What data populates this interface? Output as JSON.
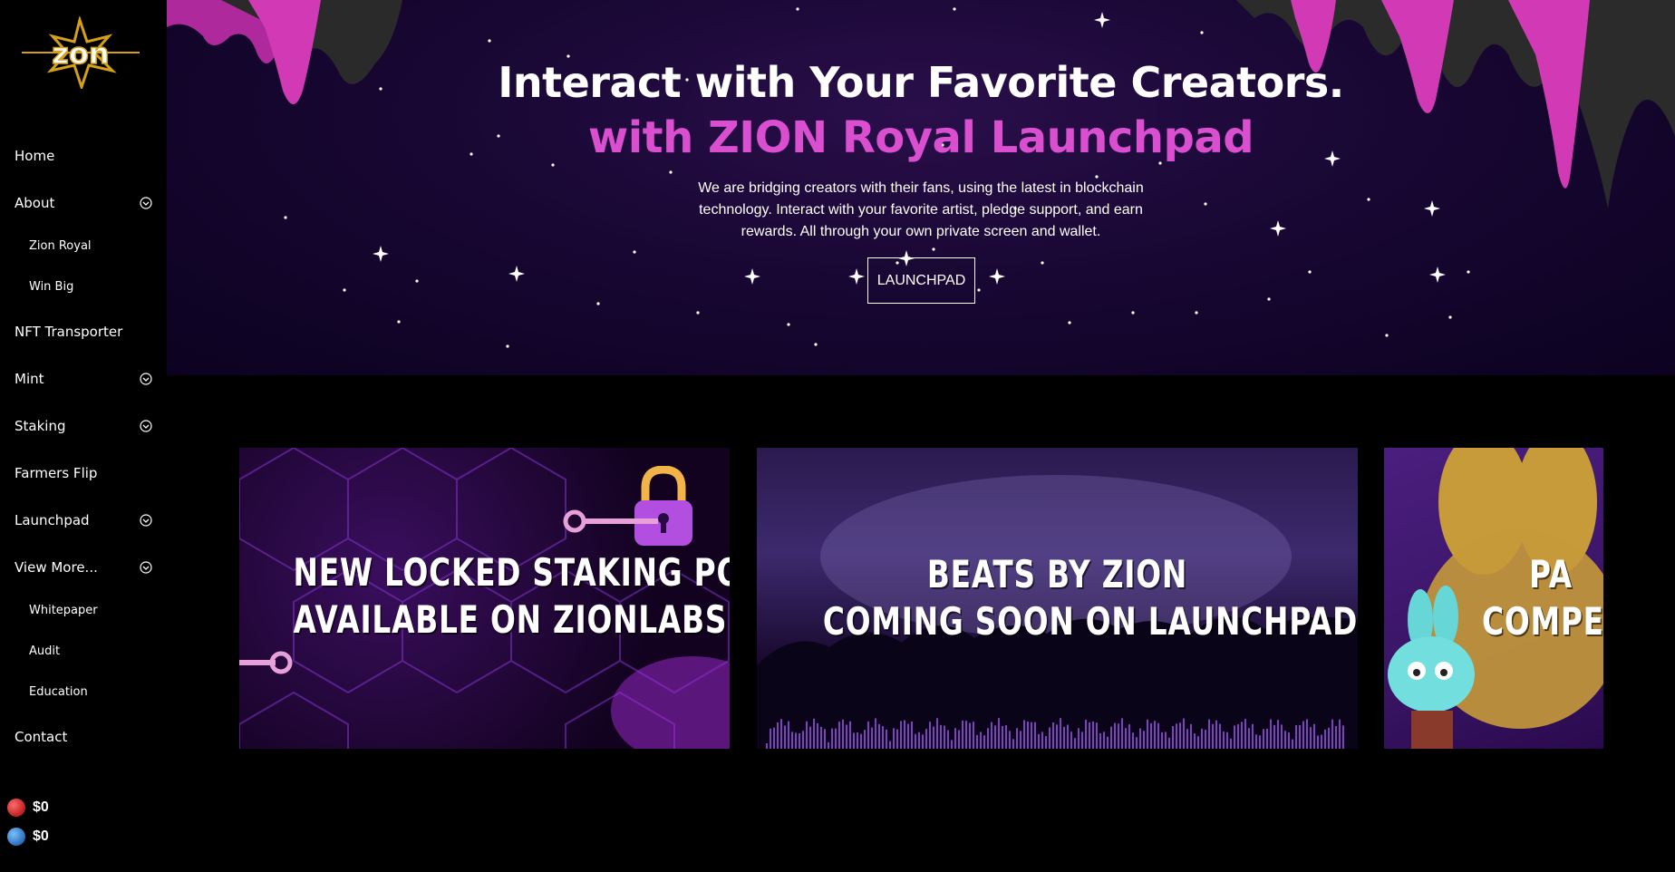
{
  "brand": {
    "logo_text": "zon"
  },
  "sidebar": {
    "items": [
      {
        "label": "Home",
        "has_chevron": false,
        "sub": false
      },
      {
        "label": "About",
        "has_chevron": true,
        "sub": false
      },
      {
        "label": "Zion Royal",
        "has_chevron": false,
        "sub": true
      },
      {
        "label": "Win Big",
        "has_chevron": false,
        "sub": true
      },
      {
        "label": "NFT Transporter",
        "has_chevron": false,
        "sub": false
      },
      {
        "label": "Mint",
        "has_chevron": true,
        "sub": false
      },
      {
        "label": "Staking",
        "has_chevron": true,
        "sub": false
      },
      {
        "label": "Farmers Flip",
        "has_chevron": false,
        "sub": false
      },
      {
        "label": "Launchpad",
        "has_chevron": true,
        "sub": false
      },
      {
        "label": "View More...",
        "has_chevron": true,
        "sub": false
      },
      {
        "label": "Whitepaper",
        "has_chevron": false,
        "sub": true
      },
      {
        "label": "Audit",
        "has_chevron": false,
        "sub": true
      },
      {
        "label": "Education",
        "has_chevron": false,
        "sub": true
      },
      {
        "label": "Contact",
        "has_chevron": false,
        "sub": false
      }
    ],
    "balances": [
      {
        "icon": "red-token-icon",
        "value": "$0"
      },
      {
        "icon": "blue-token-icon",
        "value": "$0"
      }
    ]
  },
  "hero": {
    "title": "Interact with Your Favorite Creators.",
    "subtitle": "with ZION Royal Launchpad",
    "description": "We are bridging creators with their fans, using the latest in blockchain technology. Interact with your favorite artist, pledge support, and earn rewards. All through your own private screen and wallet.",
    "button_label": "LAUNCHPAD"
  },
  "cards": [
    {
      "line1": "NEW LOCKED STAKING POOLS",
      "line2": "AVAILABLE ON ZIONLABS"
    },
    {
      "line1": "BEATS BY ZION",
      "line2": "COMING SOON ON LAUNCHPAD"
    },
    {
      "line1": "PA",
      "line2": "COMPET"
    }
  ],
  "colors": {
    "accent": "#d94fd0",
    "background": "#000000",
    "hero_bg": "#180733"
  }
}
